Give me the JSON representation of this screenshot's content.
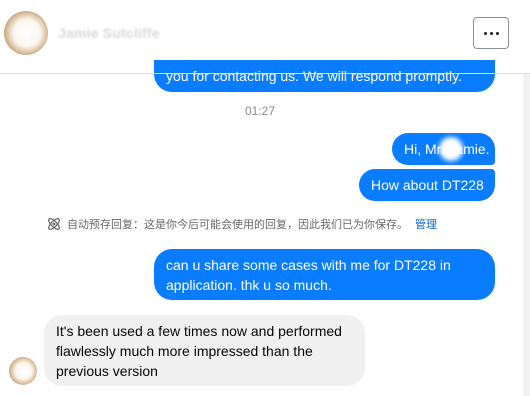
{
  "header": {
    "contact_name": "Jamie Sutcliffe",
    "more_icon": "more-horizontal-icon"
  },
  "messages": {
    "truncated_outgoing": "you for contacting us. We will respond promptly.",
    "timestamp": "01:27",
    "hi": "Hi, Mr. Jamie.",
    "how_about": "How about DT228",
    "notice": {
      "icon": "auto-reply-atom-icon",
      "text": "自动预存回复：这是你今后可能会使用的回复，因此我们已为你保存。",
      "manage_link": "管理"
    },
    "share_request": "can u share some cases with me for DT228 in application. thk u so much.",
    "incoming_reply": "It's been used a few times now and performed flawlessly much more impressed than the previous version"
  },
  "colors": {
    "outgoing_bubble": "#0a7cff",
    "incoming_bubble": "#f0f0f0",
    "link": "#0a62c9"
  }
}
